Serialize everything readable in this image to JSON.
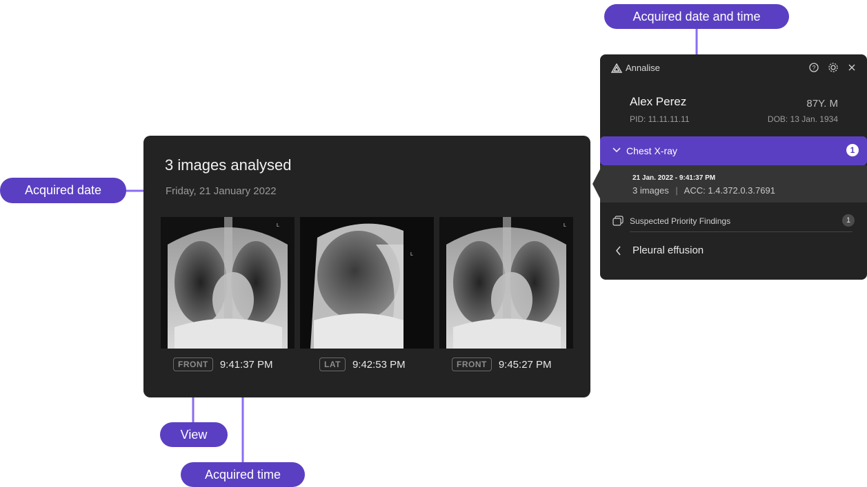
{
  "callouts": {
    "acquired_date": "Acquired date",
    "acquired_date_time": "Acquired date and time",
    "view": "View",
    "acquired_time": "Acquired time"
  },
  "card": {
    "title": "3 images analysed",
    "date": "Friday, 21 January 2022",
    "images": [
      {
        "view": "FRONT",
        "time": "9:41:37 PM"
      },
      {
        "view": "LAT",
        "time": "9:42:53 PM"
      },
      {
        "view": "FRONT",
        "time": "9:45:27 PM"
      }
    ]
  },
  "panel": {
    "brand": "Annalise",
    "icons": [
      "help-icon",
      "settings-icon",
      "close-icon"
    ],
    "patient": {
      "name": "Alex Perez",
      "age_sex": "87Y. M",
      "pid": "PID: 11.11.11.11",
      "dob": "DOB: 13 Jan. 1934"
    },
    "exam": {
      "label": "Chest X-ray",
      "count": "1"
    },
    "study": {
      "datetime": "21 Jan. 2022 - 9:41:37 PM",
      "images": "3 images",
      "acc": "ACC: 1.4.372.0.3.7691"
    },
    "findings": {
      "label": "Suspected Priority Findings",
      "count": "1"
    },
    "finding_item": "Pleural effusion"
  },
  "colors": {
    "accent": "#5b3fc2",
    "arrow": "#8a6cf0",
    "panel_bg": "#232323"
  }
}
